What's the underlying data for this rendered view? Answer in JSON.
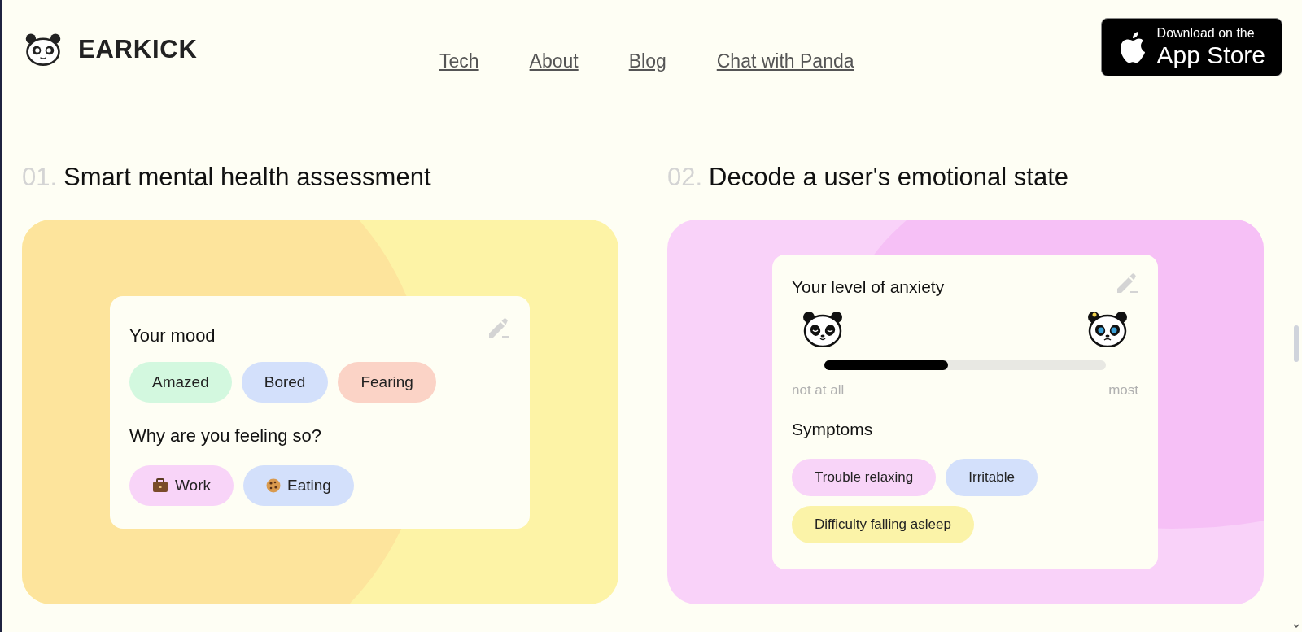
{
  "logo": {
    "text": "EARKICK"
  },
  "nav": [
    {
      "label": "Tech"
    },
    {
      "label": "About"
    },
    {
      "label": "Blog"
    },
    {
      "label": "Chat with Panda"
    }
  ],
  "app_store_button": {
    "line_1": "Download on the",
    "line_2": "App Store"
  },
  "sections": [
    {
      "number": "01.",
      "title": "Smart mental health assessment",
      "kind": "mood",
      "card": {
        "title": "Your mood",
        "chips": [
          {
            "label": "Amazed",
            "color": "#d3f8df"
          },
          {
            "label": "Bored",
            "color": "#d3e0fb"
          },
          {
            "label": "Fearing",
            "color": "#fbd3c6"
          }
        ],
        "subtitle": "Why are you feeling so?",
        "reasons": [
          {
            "label": "Work",
            "kind": "briefcase",
            "color": "#f8d4f8"
          },
          {
            "label": "Eating",
            "kind": "cookie",
            "color": "#d3e0fb"
          }
        ]
      }
    },
    {
      "number": "02.",
      "title": "Decode a user's emotional state",
      "kind": "anxiety",
      "card": {
        "title": "Your level of anxiety",
        "level": 0.44,
        "min_label": "not at all",
        "max_label": "most",
        "subtitle": "Symptoms",
        "chips": [
          {
            "label": "Trouble relaxing",
            "color": "#f8d4f8"
          },
          {
            "label": "Irritable",
            "color": "#d3e0fb"
          },
          {
            "label": "Difficulty falling asleep",
            "color": "#fbf3a8"
          }
        ]
      }
    }
  ]
}
